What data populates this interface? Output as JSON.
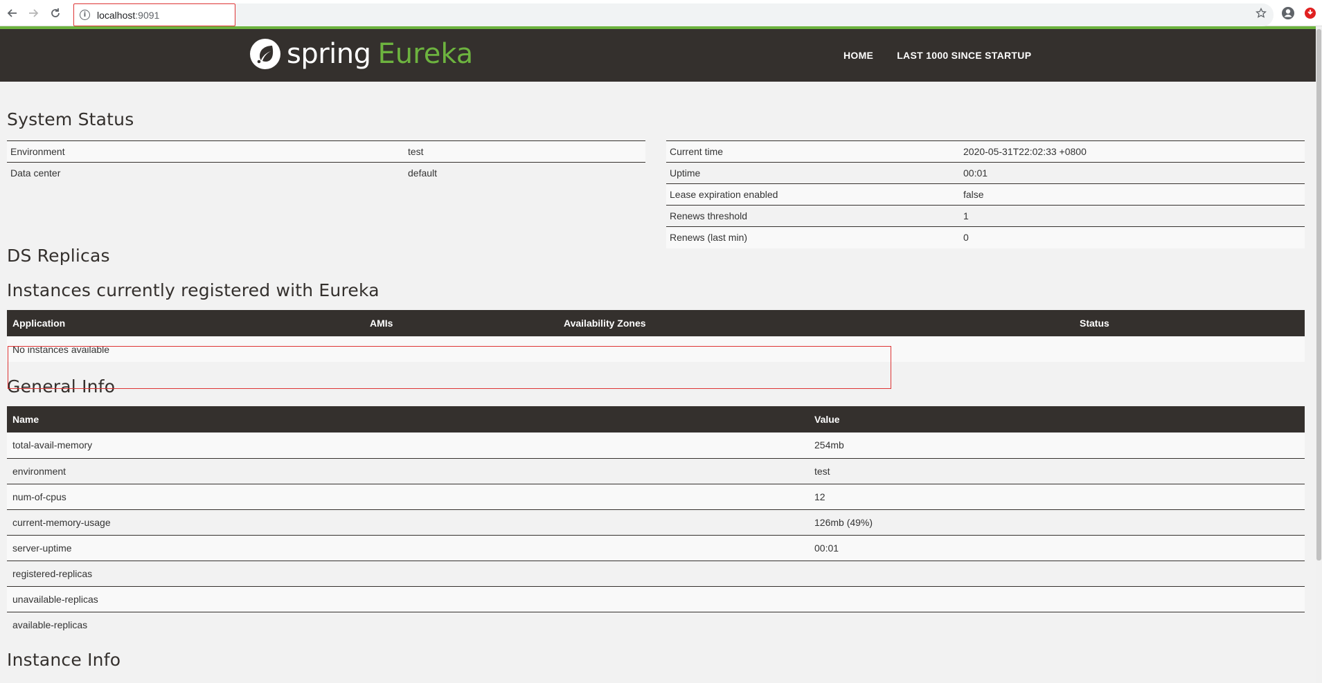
{
  "browser": {
    "url_host": "localhost",
    "url_port": ":9091"
  },
  "navbar": {
    "brand_spring": "spring",
    "brand_eureka": "Eureka",
    "links": [
      "HOME",
      "LAST 1000 SINCE STARTUP"
    ]
  },
  "system_status": {
    "title": "System Status",
    "left": [
      {
        "key": "Environment",
        "value": "test"
      },
      {
        "key": "Data center",
        "value": "default"
      }
    ],
    "right": [
      {
        "key": "Current time",
        "value": "2020-05-31T22:02:33 +0800"
      },
      {
        "key": "Uptime",
        "value": "00:01"
      },
      {
        "key": "Lease expiration enabled",
        "value": "false"
      },
      {
        "key": "Renews threshold",
        "value": "1"
      },
      {
        "key": "Renews (last min)",
        "value": "0"
      }
    ]
  },
  "ds_replicas": {
    "title": "DS Replicas"
  },
  "instances": {
    "title": "Instances currently registered with Eureka",
    "headers": [
      "Application",
      "AMIs",
      "Availability Zones",
      "Status"
    ],
    "empty_text": "No instances available"
  },
  "general_info": {
    "title": "General Info",
    "headers": [
      "Name",
      "Value"
    ],
    "rows": [
      {
        "name": "total-avail-memory",
        "value": "254mb"
      },
      {
        "name": "environment",
        "value": "test"
      },
      {
        "name": "num-of-cpus",
        "value": "12"
      },
      {
        "name": "current-memory-usage",
        "value": "126mb (49%)"
      },
      {
        "name": "server-uptime",
        "value": "00:01"
      },
      {
        "name": "registered-replicas",
        "value": ""
      },
      {
        "name": "unavailable-replicas",
        "value": ""
      },
      {
        "name": "available-replicas",
        "value": ""
      }
    ]
  },
  "instance_info": {
    "title": "Instance Info"
  },
  "colors": {
    "navbar": "#34302d",
    "accent": "#6db33f",
    "highlight": "#dd3333"
  }
}
